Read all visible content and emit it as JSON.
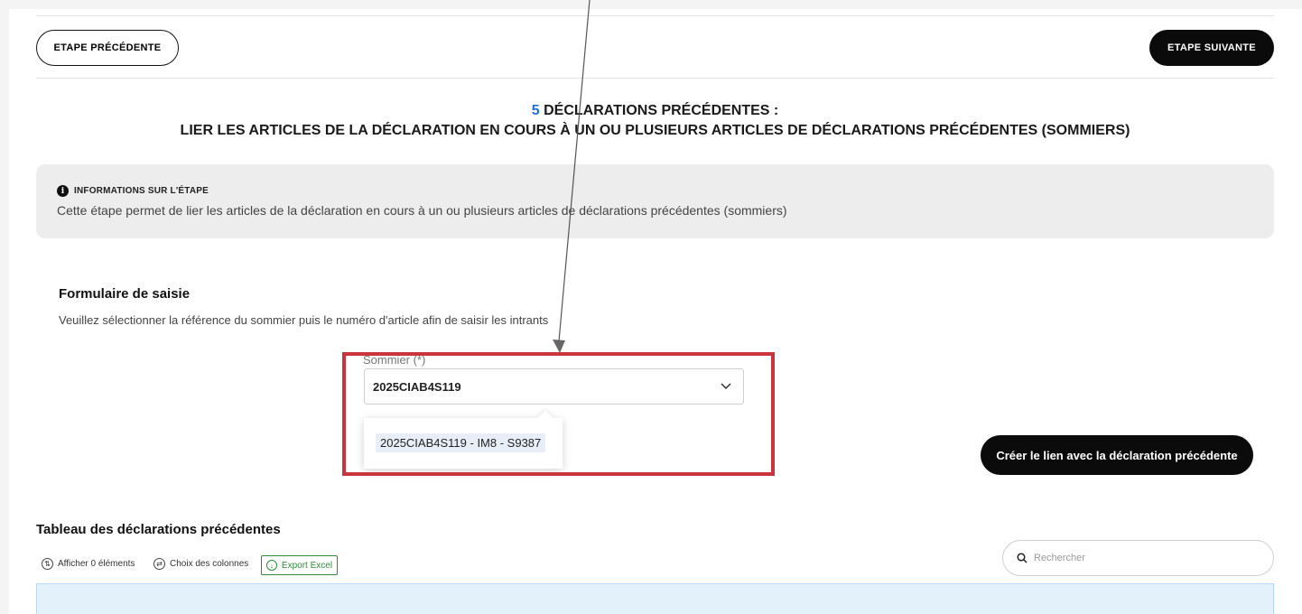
{
  "nav": {
    "prev_label": "ETAPE PRÉCÉDENTE",
    "next_label": "ETAPE SUIVANTE"
  },
  "step": {
    "number": "5",
    "title_line1": " DÉCLARATIONS PRÉCÉDENTES :",
    "title_line2": "LIER LES ARTICLES DE LA DÉCLARATION EN COURS À UN OU PLUSIEURS ARTICLES DE DÉCLARATIONS PRÉCÉDENTES (SOMMIERS)"
  },
  "info": {
    "icon": "info-icon",
    "heading": "INFORMATIONS SUR L'ÉTAPE",
    "text": "Cette étape permet de lier les articles de la déclaration en cours à un ou plusieurs articles de déclarations précédentes (sommiers)"
  },
  "form": {
    "title": "Formulaire de saisie",
    "description": "Veuillez sélectionner la référence du sommier puis le numéro d'article afin de saisir les intrants",
    "sommier_label": "Sommier (*)",
    "sommier_value": "2025CIAB4S119",
    "dropdown_options": [
      "2025CIAB4S119 - IM8 - S9387"
    ],
    "create_link_label": "Créer le lien avec la déclaration précédente"
  },
  "table": {
    "title": "Tableau des déclarations précédentes",
    "show_items_label": "Afficher 0 éléments",
    "columns_label": "Choix des colonnes",
    "export_label": "Export Excel",
    "search_placeholder": "Rechercher"
  },
  "colors": {
    "accent_blue": "#1f6fd6",
    "highlight_red": "#c9353b",
    "export_green": "#2e8b3a",
    "button_black": "#0b0b0b"
  }
}
